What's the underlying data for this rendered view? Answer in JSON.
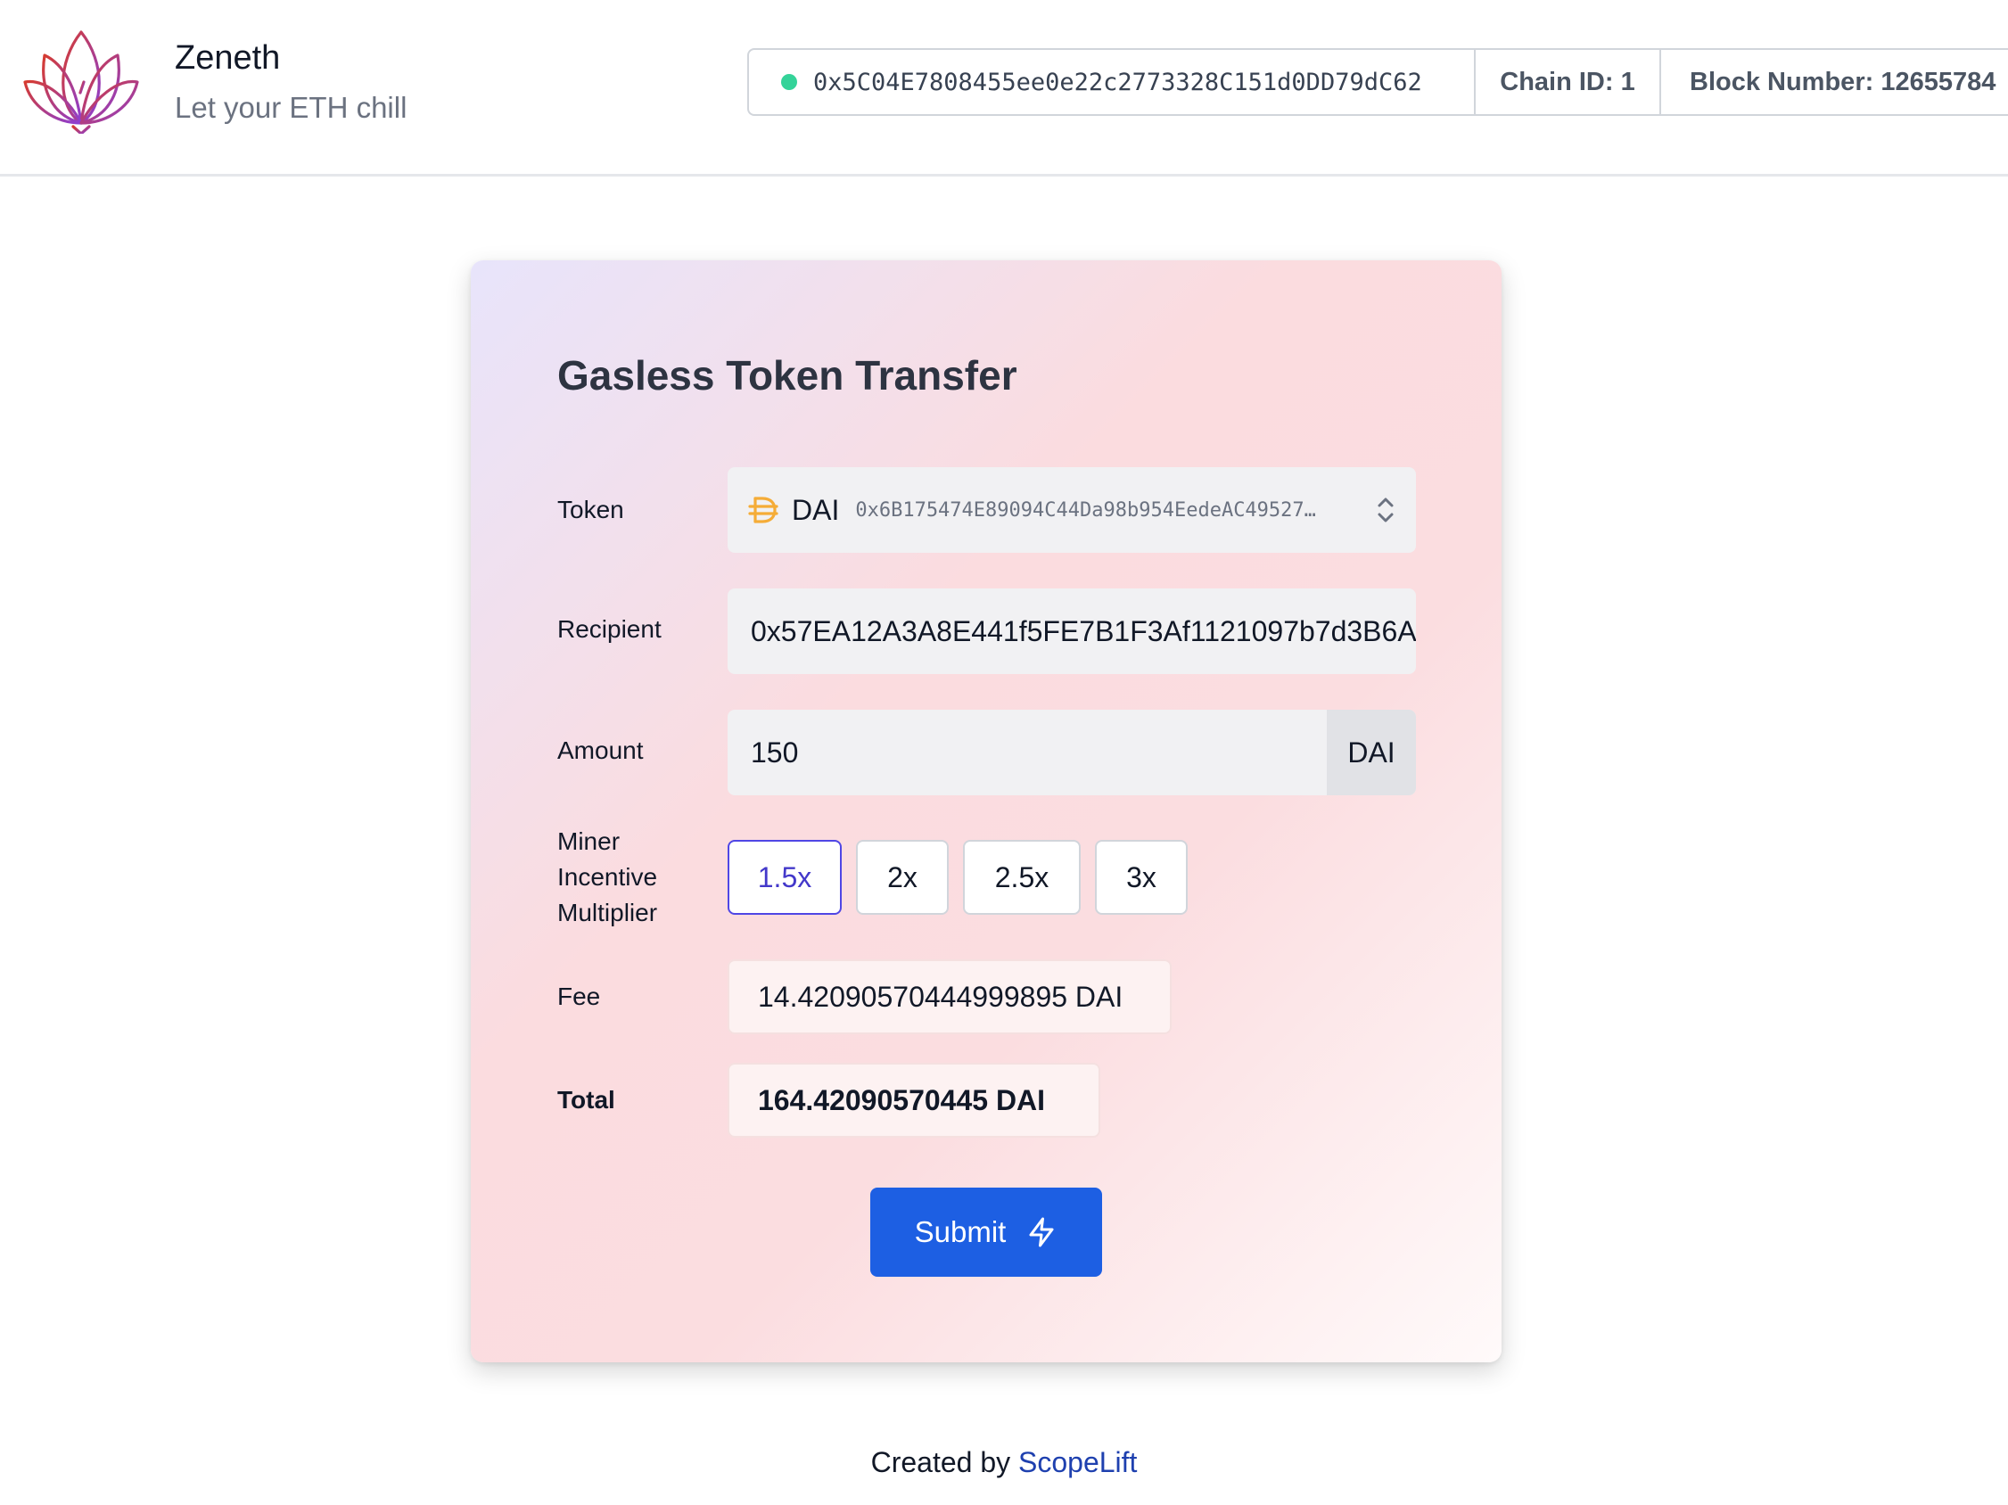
{
  "brand": {
    "name": "Zeneth",
    "tagline": "Let your ETH chill"
  },
  "network": {
    "address": "0x5C04E7808455ee0e22c2773328C151d0DD79dC62",
    "chain_id": "Chain ID: 1",
    "block_number": "Block Number: 12655784",
    "status_color": "#34d399"
  },
  "form": {
    "title": "Gasless Token Transfer",
    "token": {
      "label": "Token",
      "symbol": "DAI",
      "address": "0x6B175474E89094C44Da98b954EedeAC49527…",
      "icon": "dai-icon"
    },
    "recipient": {
      "label": "Recipient",
      "value": "0x57EA12A3A8E441f5FE7B1F3Af1121097b7d3B6A"
    },
    "amount": {
      "label": "Amount",
      "value": "150",
      "unit": "DAI"
    },
    "multiplier": {
      "label_lines": [
        "Miner",
        "Incentive",
        "Multiplier"
      ],
      "options": [
        "1.5x",
        "2x",
        "2.5x",
        "3x"
      ],
      "selected": "1.5x"
    },
    "fee": {
      "label": "Fee",
      "value": "14.42090570444999895 DAI"
    },
    "total": {
      "label": "Total",
      "value": "164.42090570445 DAI"
    },
    "submit_label": "Submit"
  },
  "footer": {
    "prefix": "Created by ",
    "link_text": "ScopeLift"
  },
  "colors": {
    "accent": "#1d5fe3",
    "selected_border": "#4f46e5",
    "token_icon": "#f5ac37"
  }
}
